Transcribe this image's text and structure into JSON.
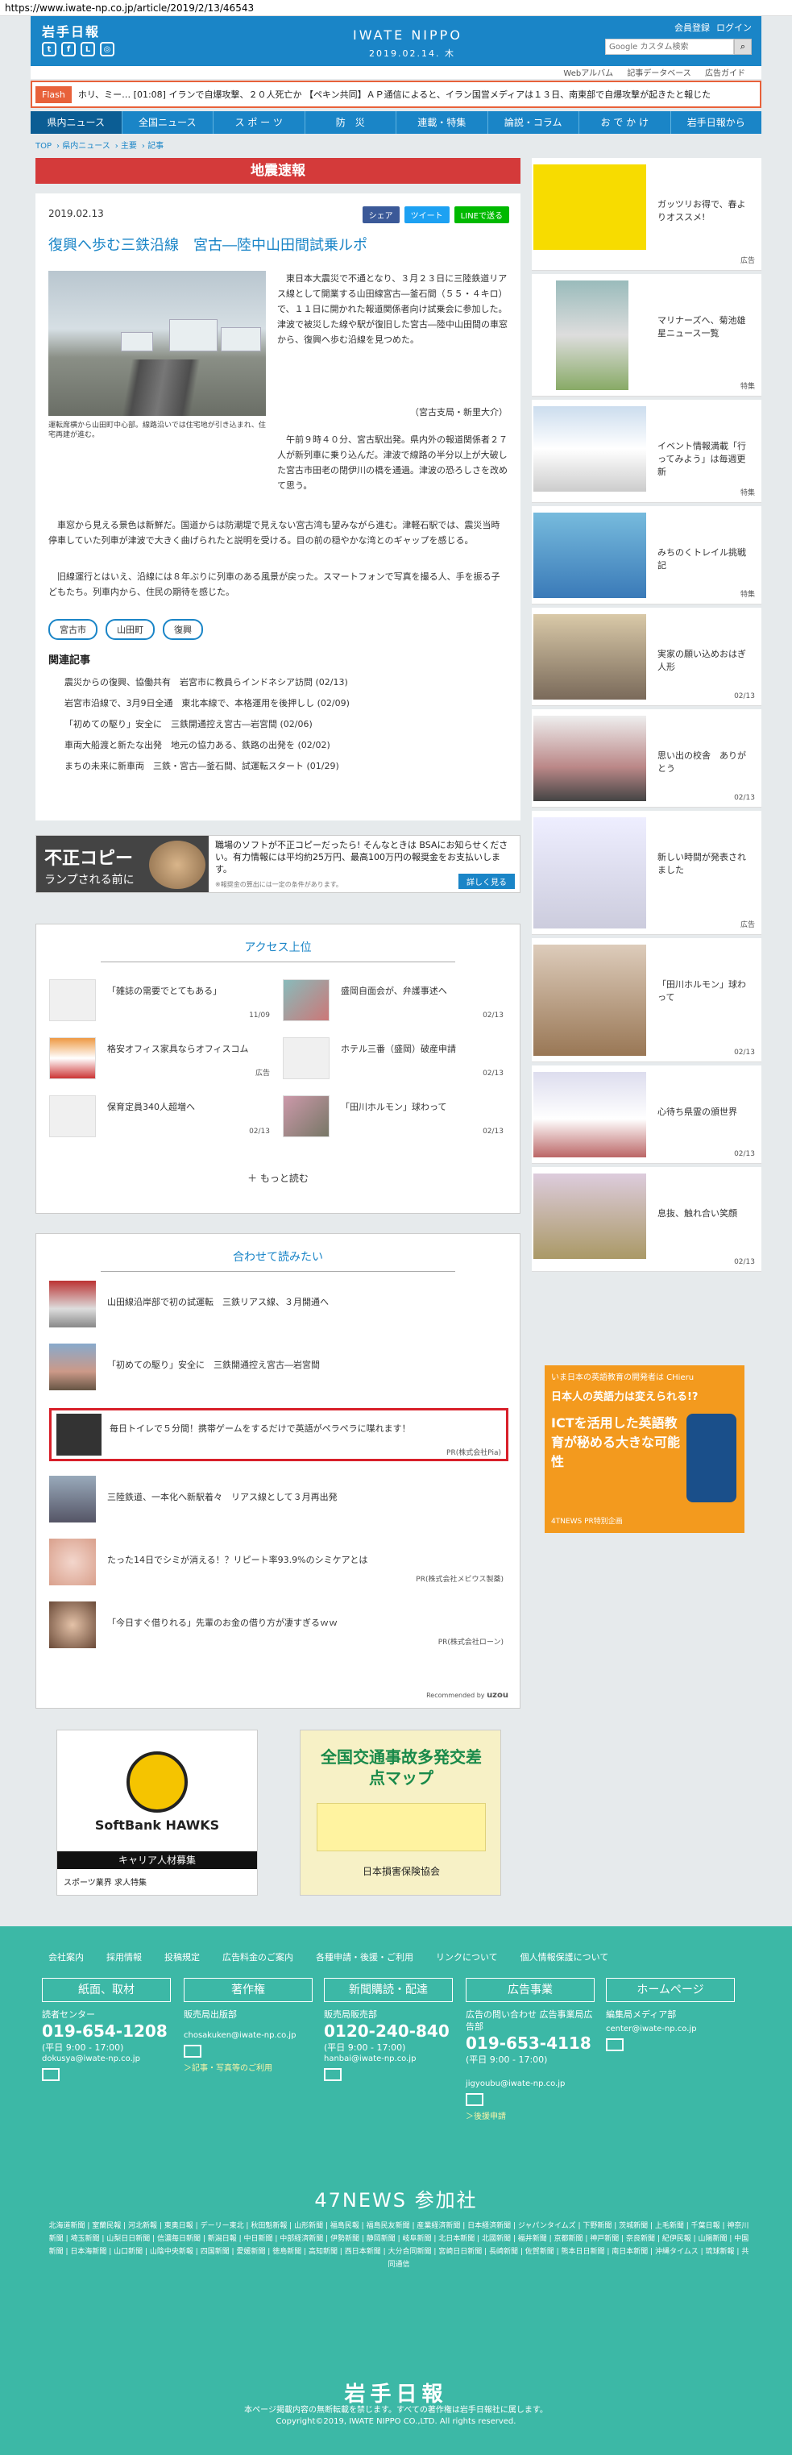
{
  "url": "https://www.iwate-np.co.jp/article/2019/2/13/46543",
  "header": {
    "brand": "岩手日報",
    "logo": "IWATE NIPPO",
    "date": "2019.02.14. 木",
    "member_link": "会員登録",
    "login_link": "ログイン",
    "search_placeholder": "Google カスタム検索",
    "sub_links": [
      "Webアルバム",
      "記事データベース",
      "広告ガイド"
    ]
  },
  "flash": {
    "label": "Flash",
    "text": "ホリ、ミー… [01:08] イランで自爆攻撃、２０人死亡か 【ペキン共同】ＡＰ通信によると、イラン国営メディアは１３日、南東部で自爆攻撃が起きたと報じた"
  },
  "nav": [
    "県内ニュース",
    "全国ニュース",
    "ス ポ ー ツ",
    "防　災",
    "連載・特集",
    "論説・コラム",
    "お で か け",
    "岩手日報から"
  ],
  "breadcrumb": [
    "TOP",
    "県内ニュース",
    "主要",
    "記事"
  ],
  "quake_banner": "地震速報",
  "article": {
    "date": "2019.02.13",
    "share_fb": "シェア",
    "share_tw": "ツイート",
    "share_line": "LINEで送る",
    "title": "復興へ歩む三鉄沿線　宮古―陸中山田間試乗ルポ",
    "caption": "運転席横から山田町中心部。線路沿いでは住宅地が引き込まれ、住宅再建が進む。",
    "p1": "　東日本大震災で不通となり、３月２３日に三陸鉄道リアス線として開業する山田線宮古―釜石間（５５・４キロ）で、１１日に開かれた報道関係者向け試乗会に参加した。津波で被災した線や駅が復旧した宮古―陸中山田間の車窓から、復興へ歩む沿線を見つめた。",
    "p1b": "（宮古支局・新里大介）",
    "p2": "　午前９時４０分、宮古駅出発。県内外の報道関係者２７人が新列車に乗り込んだ。津波で線路の半分以上が大破した宮古市田老の閉伊川の橋を通過。津波の恐ろしさを改めて思う。",
    "p3": "　車窓から見える景色は新鮮だ。国道からは防潮堤で見えない宮古湾も望みながら進む。津軽石駅では、震災当時停車していた列車が津波で大きく曲げられたと説明を受ける。目の前の穏やかな湾とのギャップを感じる。",
    "p4": "　旧線運行とはいえ、沿線には８年ぶりに列車のある風景が戻った。スマートフォンで写真を撮る人、手を振る子どもたち。列車内から、住民の期待を感じた。",
    "tags": [
      "宮古市",
      "山田町",
      "復興"
    ],
    "related_title": "関連記事",
    "related": [
      "震災からの復興、協働共有　岩宮市に教員らインドネシア訪問 (02/13)",
      "岩宮市沿線で、3月9日全通　東北本線で、本格運用を後押しし (02/09)",
      "「初めての駆り」安全に　三鉄開通控え宮古―岩宮間 (02/06)",
      "車両大船渡と新たな出発　地元の協力ある、鉄路の出発を (02/02)",
      "まちの未来に新車両　三鉄・宮古―釜石間、試運転スタート (01/29)"
    ]
  },
  "ad_banner": {
    "headline": "不正コピー",
    "sub": "ランプされる前に",
    "text": "職場のソフトが不正コピーだったら! そんなときは BSAにお知らせください。有力情報には平均約25万円、最高100万円の報奨金をお支払いします。",
    "note": "※報奨金の算出には一定の条件があります。",
    "button": "詳しく見る"
  },
  "access": {
    "title": "アクセス上位",
    "items": [
      {
        "title": "「雑誌の需要でとてもある」",
        "date": "11/09"
      },
      {
        "title": "盛岡自面会が、弁護事述へ",
        "date": "02/13"
      },
      {
        "title": "格安オフィス家具ならオフィスコム",
        "date": "広告"
      },
      {
        "title": "ホテル三番（盛岡）破産申請",
        "date": "02/13"
      },
      {
        "title": "保育定員340人超増へ",
        "date": "02/13"
      },
      {
        "title": "「田川ホルモン」球わって",
        "date": "02/13"
      }
    ],
    "more": "もっと読む"
  },
  "recommend": {
    "title": "合わせて読みたい",
    "items": [
      {
        "title": "山田線沿岸部で初の試運転　三鉄リアス線、３月開通へ",
        "pr": ""
      },
      {
        "title": "「初めての駆り」安全に　三鉄開通控え宮古―岩宮間",
        "pr": ""
      },
      {
        "title": "毎日トイレで５分間！携帯ゲームをするだけで英語がペラペラに喋れます！",
        "pr": "PR(株式会社Pia)"
      },
      {
        "title": "三陸鉄道、一本化へ新駅着々　リアス線として３月再出発",
        "pr": ""
      },
      {
        "title": "たった14日でシミが消える！？リピート率93.9%のシミケアとは",
        "pr": "PR(株式会社メビウス製薬)"
      },
      {
        "title": "「今日すぐ借りれる」先輩のお金の借り方が凄すぎるｗｗ",
        "pr": "PR(株式会社ローン)"
      }
    ],
    "footer": "Recommended by"
  },
  "bottom_ads": {
    "ad1_brand": "SoftBank HAWKS",
    "ad1_sub": "キャリア人材募集",
    "ad1_foot": "スポーツ業界 求人特集",
    "ad2_title": "全国交通事故多発交差点マップ",
    "ad2_sub": "日本損害保険協会"
  },
  "sidebar": [
    {
      "title": "ガッツリお得で、春よりオススメ!",
      "label": "広告"
    },
    {
      "title": "マリナーズへ、菊池雄星ニュース一覧",
      "label": "特集"
    },
    {
      "title": "イベント情報満載「行ってみよう」は毎週更新",
      "label": "特集"
    },
    {
      "title": "みちのくトレイル挑戦記",
      "label": "特集"
    },
    {
      "title": "実家の願い込めおはぎ人形",
      "label": "02/13"
    },
    {
      "title": "思い出の校舎　ありがとう",
      "label": "02/13"
    },
    {
      "title": "新しい時間が発表されました",
      "label": "広告"
    },
    {
      "title": "「田川ホルモン」球わって",
      "label": "02/13"
    },
    {
      "title": "心待ち県霊の頒世界",
      "label": "02/13"
    },
    {
      "title": "息抜、触れ合い笑顔",
      "label": "02/13"
    }
  ],
  "side_ad": {
    "top": "いま日本の英語教育の開発者は CHieru",
    "head": "日本人の英語力は変えられる!?",
    "big": "ICTを活用した英語教育が秘める大きな可能性",
    "foot": "4TNEWS PR特別企画"
  },
  "footer": {
    "links": [
      "会社案内",
      "採用情報",
      "投稿規定",
      "広告料金のご案内",
      "各種申請・後援・ご利用",
      "リンクについて",
      "個人情報保護について"
    ],
    "cols": [
      {
        "head": "紙面、取材",
        "sub": "読者センター",
        "tel": "019-654-1208",
        "hours": "(平日 9:00 - 17:00)",
        "mail": "dokusya@iwate-np.co.jp",
        "note": ""
      },
      {
        "head": "著作権",
        "sub": "販売局出版部",
        "tel": "",
        "hours": "",
        "mail": "chosakuken@iwate-np.co.jp",
        "note": "＞記事・写真等のご利用"
      },
      {
        "head": "新聞購読・配達",
        "sub": "販売局販売部",
        "tel": "0120-240-840",
        "hours": "(平日 9:00 - 17:00)",
        "mail": "hanbai@iwate-np.co.jp",
        "note": ""
      },
      {
        "head": "広告事業",
        "sub": "広告の問い合わせ 広告事業局広告部",
        "tel": "019-653-4118",
        "hours": "(平日 9:00 - 17:00)",
        "mail": "jigyoubu@iwate-np.co.jp",
        "note": "＞後援申請"
      },
      {
        "head": "ホームページ",
        "sub": "編集局メディア部",
        "tel": "",
        "hours": "",
        "mail": "center@iwate-np.co.jp",
        "note": ""
      }
    ],
    "news47": "47NEWS 参加社",
    "papers": "北海道新聞 | 室蘭民報 | 河北新報 | 東奥日報 | デーリー東北 | 秋田魁新報 | 山形新聞 | 福島民報 | 福島民友新聞 | 産業経済新聞 | 日本経済新聞 | ジャパンタイムズ | 下野新聞 | 茨城新聞 | 上毛新聞 | 千葉日報 | 神奈川新聞 | 埼玉新聞 | 山梨日日新聞 | 信濃毎日新聞 | 新潟日報 | 中日新聞 | 中部経済新聞 | 伊勢新聞 | 静岡新聞 | 岐阜新聞 | 北日本新聞 | 北國新聞 | 福井新聞 | 京都新聞 | 神戸新聞 | 奈良新聞 | 紀伊民報 | 山陽新聞 | 中国新聞 | 日本海新聞 | 山口新聞 | 山陰中央新報 | 四国新聞 | 愛媛新聞 | 徳島新聞 | 高知新聞 | 西日本新聞 | 大分合同新聞 | 宮崎日日新聞 | 長崎新聞 | 佐賀新聞 | 熊本日日新聞 | 南日本新聞 | 沖縄タイムス | 琉球新報 | 共同通信",
    "logo": "岩手日報",
    "copy1": "本ページ掲載内容の無断転載を禁じます。すべての著作権は岩手日報社に属します。",
    "copy2": "Copyright©2019, IWATE NIPPO CO.,LTD. All rights reserved."
  }
}
